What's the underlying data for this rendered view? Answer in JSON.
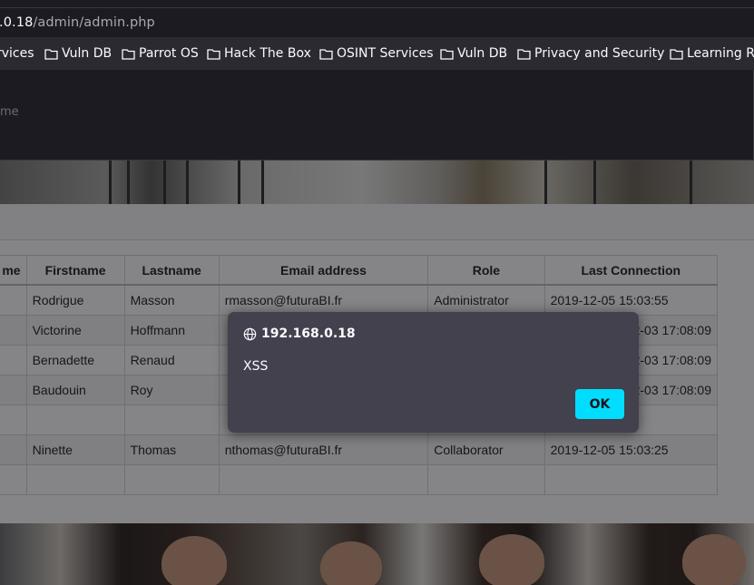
{
  "browser": {
    "url_host": ".0.18",
    "url_path": "/admin/admin.php",
    "bookmarks": [
      "rvices",
      "Vuln DB",
      "Parrot OS",
      "Hack The Box",
      "OSINT Services",
      "Vuln DB",
      "Privacy and Security",
      "Learning Re"
    ],
    "ghost_text": "me"
  },
  "table": {
    "headers": [
      "me",
      "Firstname",
      "Lastname",
      "Email address",
      "Role",
      "Last Connection"
    ],
    "rows": [
      [
        "",
        "Rodrigue",
        "Masson",
        "rmasson@futuraBI.fr",
        "Administrator",
        "2019-12-05 15:03:55"
      ],
      [
        "",
        "Victorine",
        "Hoffmann",
        "",
        "",
        "2-03 17:08:09"
      ],
      [
        "",
        "Bernadette",
        "Renaud",
        "",
        "",
        "2-03 17:08:09"
      ],
      [
        "",
        "Baudouin",
        "Roy",
        "",
        "",
        "2-03 17:08:09"
      ],
      [
        "",
        "",
        "",
        "",
        "",
        ""
      ],
      [
        "",
        "Ninette",
        "Thomas",
        "nthomas@futuraBI.fr",
        "Collaborator",
        "2019-12-05 15:03:25"
      ],
      [
        "",
        "",
        "",
        "",
        "",
        ""
      ]
    ]
  },
  "dialog": {
    "origin": "192.168.0.18",
    "message": "XSS",
    "ok_label": "OK",
    "origin_icon": "globe-icon"
  },
  "colors": {
    "accent": "#00ddff",
    "dialog_bg": "#42414d",
    "toolbar_bg": "#2b2a33"
  }
}
